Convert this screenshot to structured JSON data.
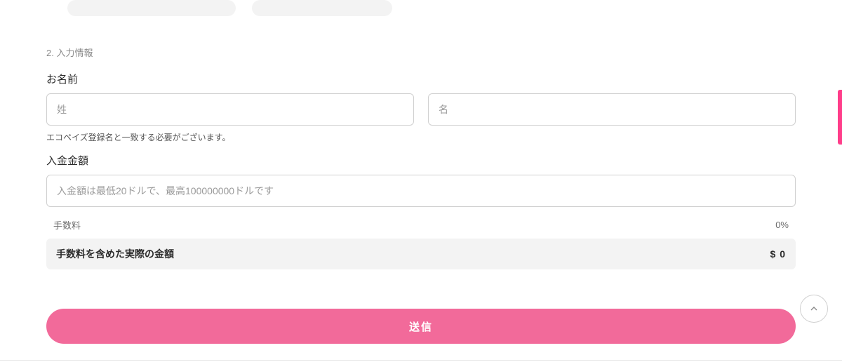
{
  "section": {
    "label": "2. 入力情報"
  },
  "name": {
    "label": "お名前",
    "last_placeholder": "姓",
    "first_placeholder": "名",
    "helper": "エコペイズ登録名と一致する必要がございます。"
  },
  "amount": {
    "label": "入金金額",
    "placeholder": "入金額は最低20ドルで、最高100000000ドルです"
  },
  "fee": {
    "label": "手数料",
    "value": "0%"
  },
  "total": {
    "label": "手数料を含めた実際の金額",
    "value": "$ 0"
  },
  "submit": {
    "label": "送信"
  }
}
